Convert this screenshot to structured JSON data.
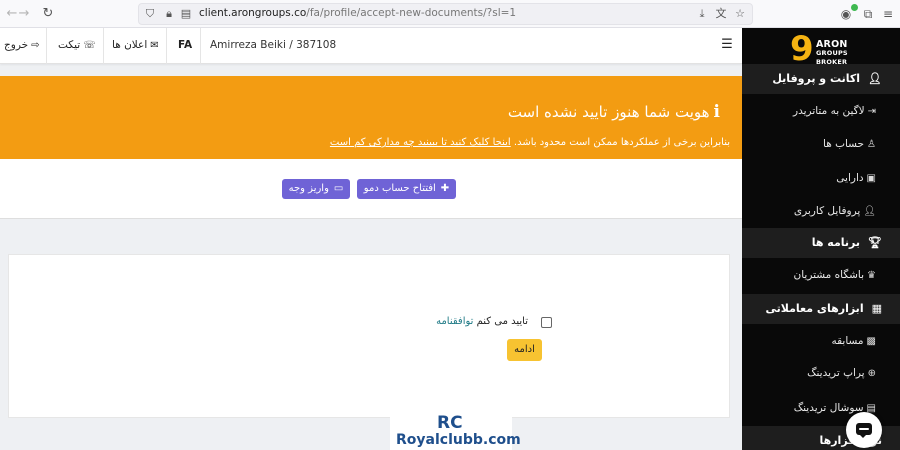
{
  "browser": {
    "url_host": "client.arongroups.co",
    "url_path": "/fa/profile/accept-new-documents/?sl=1"
  },
  "sidebar": {
    "logo_number": "9",
    "logo_word": "ARON",
    "logo_sub1": "GROUPS",
    "logo_sub2": "BROKER",
    "sections": [
      {
        "title": "اکانت و پروفایل",
        "items": [
          "لاگین به متاتریدر",
          "حساب ها",
          "دارایی",
          "پروفایل کاربری"
        ]
      },
      {
        "title": "برنامه ها",
        "items": [
          "باشگاه مشتریان"
        ]
      },
      {
        "title": "ابزارهای معاملاتی",
        "items": [
          "مسابقه",
          "پراپ تریدینگ",
          "سوشال تریدینگ"
        ]
      },
      {
        "title": "نرم افزارها",
        "items": []
      }
    ]
  },
  "header": {
    "user": "Amirreza Beiki / 387108",
    "lang": "FA",
    "announcements": "اعلان ها",
    "ticket": "تیکت",
    "logout": "خروج"
  },
  "banner": {
    "title": "هویت شما هنوز تایید نشده است",
    "text": "بنابراین برخی از عملکردها ممکن است محدود باشد.",
    "link": "اینجا کلیک کنید تا ببینید چه مدارکی کم است",
    "color": "#f39c12"
  },
  "actions": {
    "open_demo": "افتتاح حساب دمو",
    "deposit": "واریز وجه",
    "color": "#6f63d6"
  },
  "agreement": {
    "text": "تایید می کنم",
    "link": "توافقنامه",
    "continue": "ادامه",
    "checked": false
  },
  "watermark": {
    "logo": "RC",
    "text": "Royalclubb.com"
  }
}
